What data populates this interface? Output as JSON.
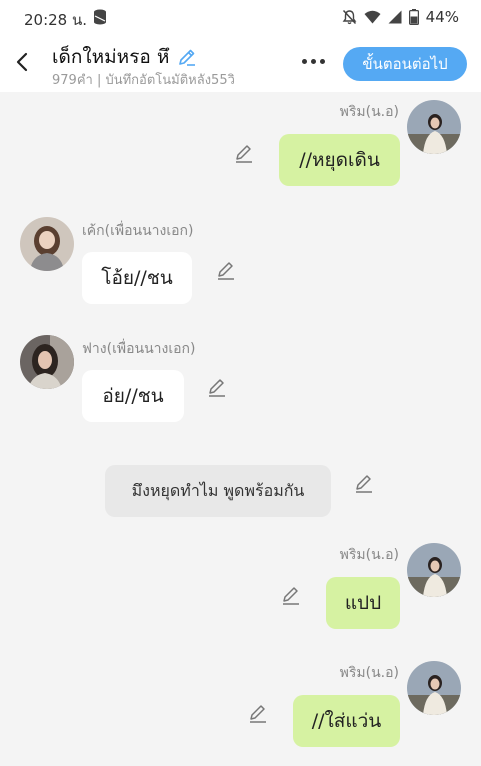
{
  "status_bar": {
    "time": "20:28 น.",
    "battery": "44%",
    "icons": [
      "database-icon",
      "mute-bell-icon",
      "wifi-icon",
      "signal-icon",
      "battery-icon"
    ]
  },
  "header": {
    "title": "เด็กใหม่หรอ หึ",
    "subtitle": "979คำ | บันทึกอัตโนมัติหลัง55วิ",
    "next_button": "ขั้นตอนต่อไป",
    "accent_color": "#55a9f3"
  },
  "messages": [
    {
      "side": "right",
      "sender": "พริม(น.อ)",
      "text": "//หยุดเดิน"
    },
    {
      "side": "left",
      "sender": "เค้ก(เพื่อนนางเอก)",
      "text": "โอ้ย//ชน"
    },
    {
      "side": "left",
      "sender": "ฟาง(เพื่อนนางเอก)",
      "text": "อ่ย//ชน"
    },
    {
      "side": "center",
      "text": "มึงหยุดทำไม พูดพร้อมกัน"
    },
    {
      "side": "right",
      "sender": "พริม(น.อ)",
      "text": "แปป"
    },
    {
      "side": "right",
      "sender": "พริม(น.อ)",
      "text": "//ใส่แว่น"
    }
  ],
  "colors": {
    "right_bubble": "#d6f2a2",
    "left_bubble": "#ffffff",
    "center_bubble": "#e8e8e8",
    "background": "#f4f4f4"
  }
}
